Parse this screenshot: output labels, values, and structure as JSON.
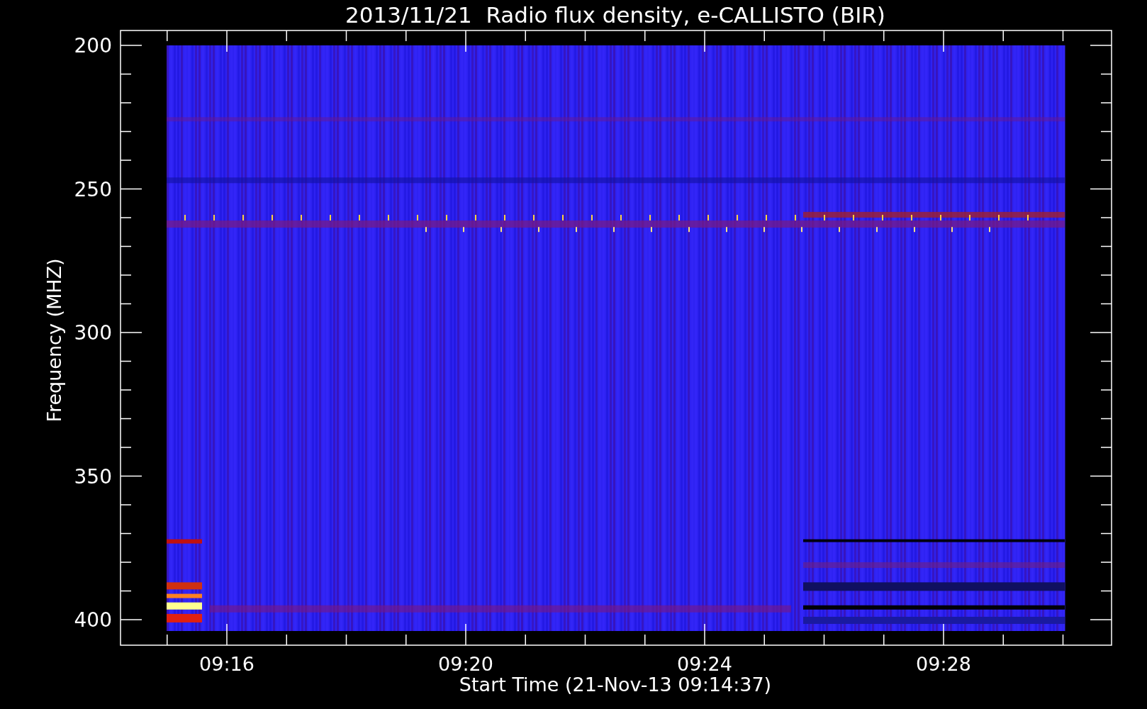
{
  "title": "2013/11/21  Radio flux density, e-CALLISTO (BIR)",
  "y_axis": {
    "label": "Frequency (MHZ)",
    "ticks": [
      "200",
      "250",
      "300",
      "350",
      "400"
    ]
  },
  "x_axis": {
    "label": "Start Time (21-Nov-13 09:14:37)",
    "ticks": [
      "09:16",
      "09:20",
      "09:24",
      "09:28"
    ]
  }
}
